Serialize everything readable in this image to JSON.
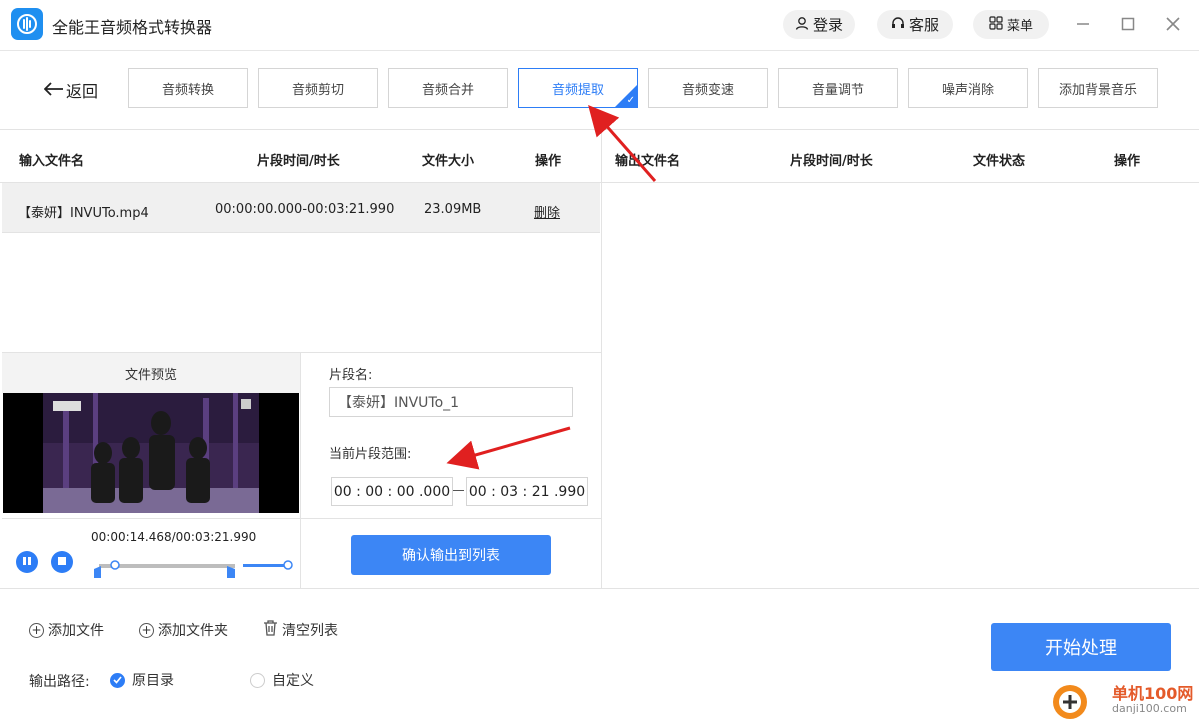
{
  "app": {
    "title": "全能王音频格式转换器"
  },
  "header": {
    "login": "登录",
    "service": "客服",
    "menu": "菜单"
  },
  "nav": {
    "back": "返回",
    "tabs": [
      "音频转换",
      "音频剪切",
      "音频合并",
      "音频提取",
      "音频变速",
      "音量调节",
      "噪声消除",
      "添加背景音乐"
    ],
    "active_tab": "音频提取"
  },
  "input_table": {
    "headers": [
      "输入文件名",
      "片段时间/时长",
      "文件大小",
      "操作"
    ],
    "rows": [
      {
        "name": "【泰妍】INVUTo.mp4",
        "range": "00:00:00.000-00:03:21.990",
        "size": "23.09MB",
        "action": "删除"
      }
    ]
  },
  "output_table": {
    "headers": [
      "输出文件名",
      "片段时间/时长",
      "文件状态",
      "操作"
    ]
  },
  "preview": {
    "title": "文件预览",
    "time": "00:00:14.468/00:03:21.990"
  },
  "segment": {
    "name_label": "片段名:",
    "name_value": "【泰妍】INVUTo_1",
    "range_label": "当前片段范围:",
    "start": "00 : 00 : 00 .000",
    "end": "00 : 03 : 21 .990",
    "confirm": "确认输出到列表"
  },
  "toolbar": {
    "add_file": "添加文件",
    "add_folder": "添加文件夹",
    "clear_list": "清空列表"
  },
  "output_path": {
    "label": "输出路径:",
    "original": "原目录",
    "custom": "自定义",
    "selected": "原目录"
  },
  "start_button": "开始处理",
  "watermark": {
    "text": "单机100网",
    "url": "danji100.com"
  },
  "colors": {
    "accent": "#2d7df6",
    "arrow": "#e02020"
  }
}
